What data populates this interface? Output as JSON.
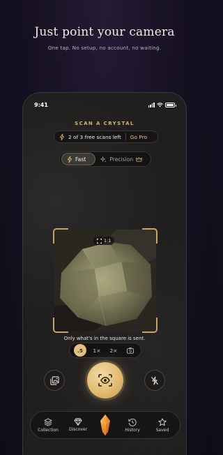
{
  "marketing": {
    "headline": "Just point your camera",
    "subline": "One tap. No setup, no account, no waiting."
  },
  "status_bar": {
    "time": "9:41"
  },
  "scanner": {
    "title": "SCAN A CRYSTAL",
    "free_scans": "2 of 3 free scans left",
    "go_pro": "Go Pro",
    "modes": [
      {
        "label": "Fast",
        "icon": "bolt-icon",
        "active": true
      },
      {
        "label": "Precision",
        "icon": "sparkle-icon",
        "active": false
      }
    ],
    "aspect_badge": "1:1",
    "hint": "Only what's in the square is sent.",
    "zoom": [
      {
        "label": ".5",
        "active": true
      },
      {
        "label": "1×",
        "active": false
      },
      {
        "label": "2×",
        "active": false
      }
    ],
    "icons": {
      "gallery": "gallery-icon",
      "shutter": "scan-eye-icon",
      "flash": "flash-off-icon",
      "flip": "flip-camera-icon"
    }
  },
  "tabbar": {
    "items": [
      {
        "label": "Collection",
        "icon": "layers-icon"
      },
      {
        "label": "Discover",
        "icon": "gem-icon"
      },
      {
        "label": "",
        "icon": "crystal-icon"
      },
      {
        "label": "History",
        "icon": "history-icon"
      },
      {
        "label": "Saved",
        "icon": "star-icon"
      }
    ]
  },
  "colors": {
    "accent_gold": "#e3c07c",
    "background": "#151020",
    "panel": "#1f1e1d"
  }
}
